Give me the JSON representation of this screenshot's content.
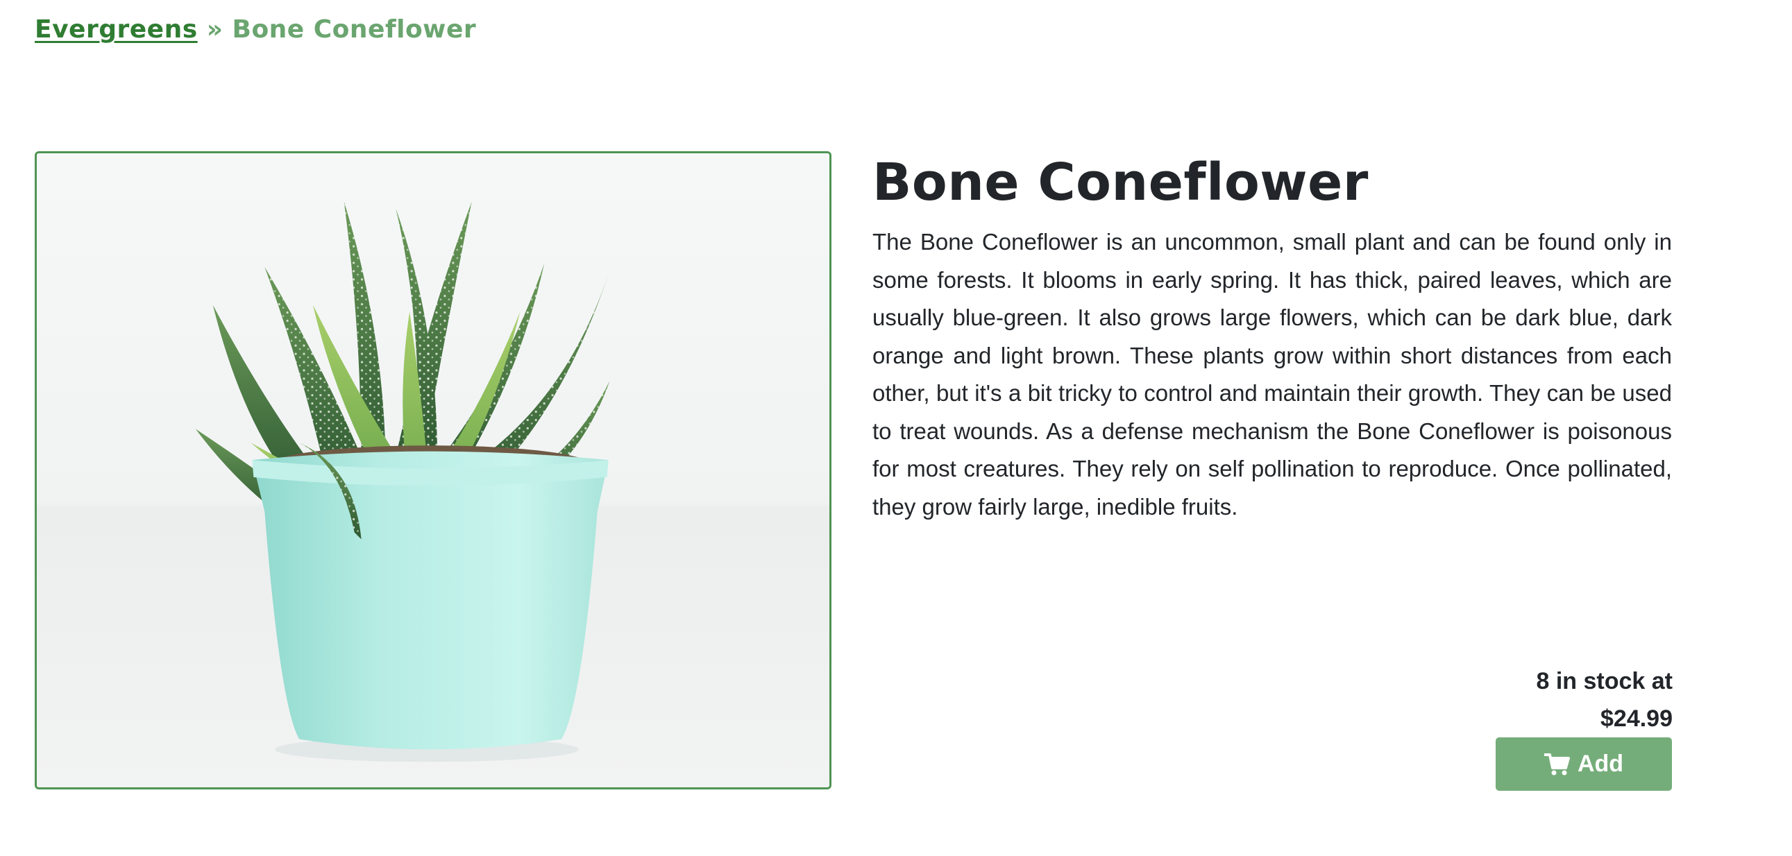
{
  "breadcrumb": {
    "parent_label": "Evergreens",
    "separator": "»",
    "current_label": "Bone Coneflower"
  },
  "product": {
    "title": "Bone Coneflower",
    "description": "The Bone Coneflower is an uncommon, small plant and can be found only in some forests. It blooms in early spring. It has thick, paired leaves, which are usually blue-green. It also grows large flowers, which can be dark blue, dark orange and light brown. These plants grow within short distances from each other, but it's a bit tricky to control and maintain their growth. They can be used to treat wounds. As a defense mechanism the Bone Coneflower is poisonous for most creatures. They rely on self pollination to reproduce. Once pollinated, they grow fairly large, inedible fruits.",
    "stock_text": "8 in stock at",
    "price": "$24.99",
    "add_label": "Add",
    "image_subject": "succulent in mint-green pot"
  },
  "icons": {
    "cart": "shopping-cart-icon"
  },
  "colors": {
    "accent": "#2f7d32",
    "breadcrumb_current": "#6aa56f",
    "frame_border": "#4e9453",
    "button_bg": "#75ad7a",
    "button_text": "#ffffff",
    "pot": "#aee8df"
  }
}
